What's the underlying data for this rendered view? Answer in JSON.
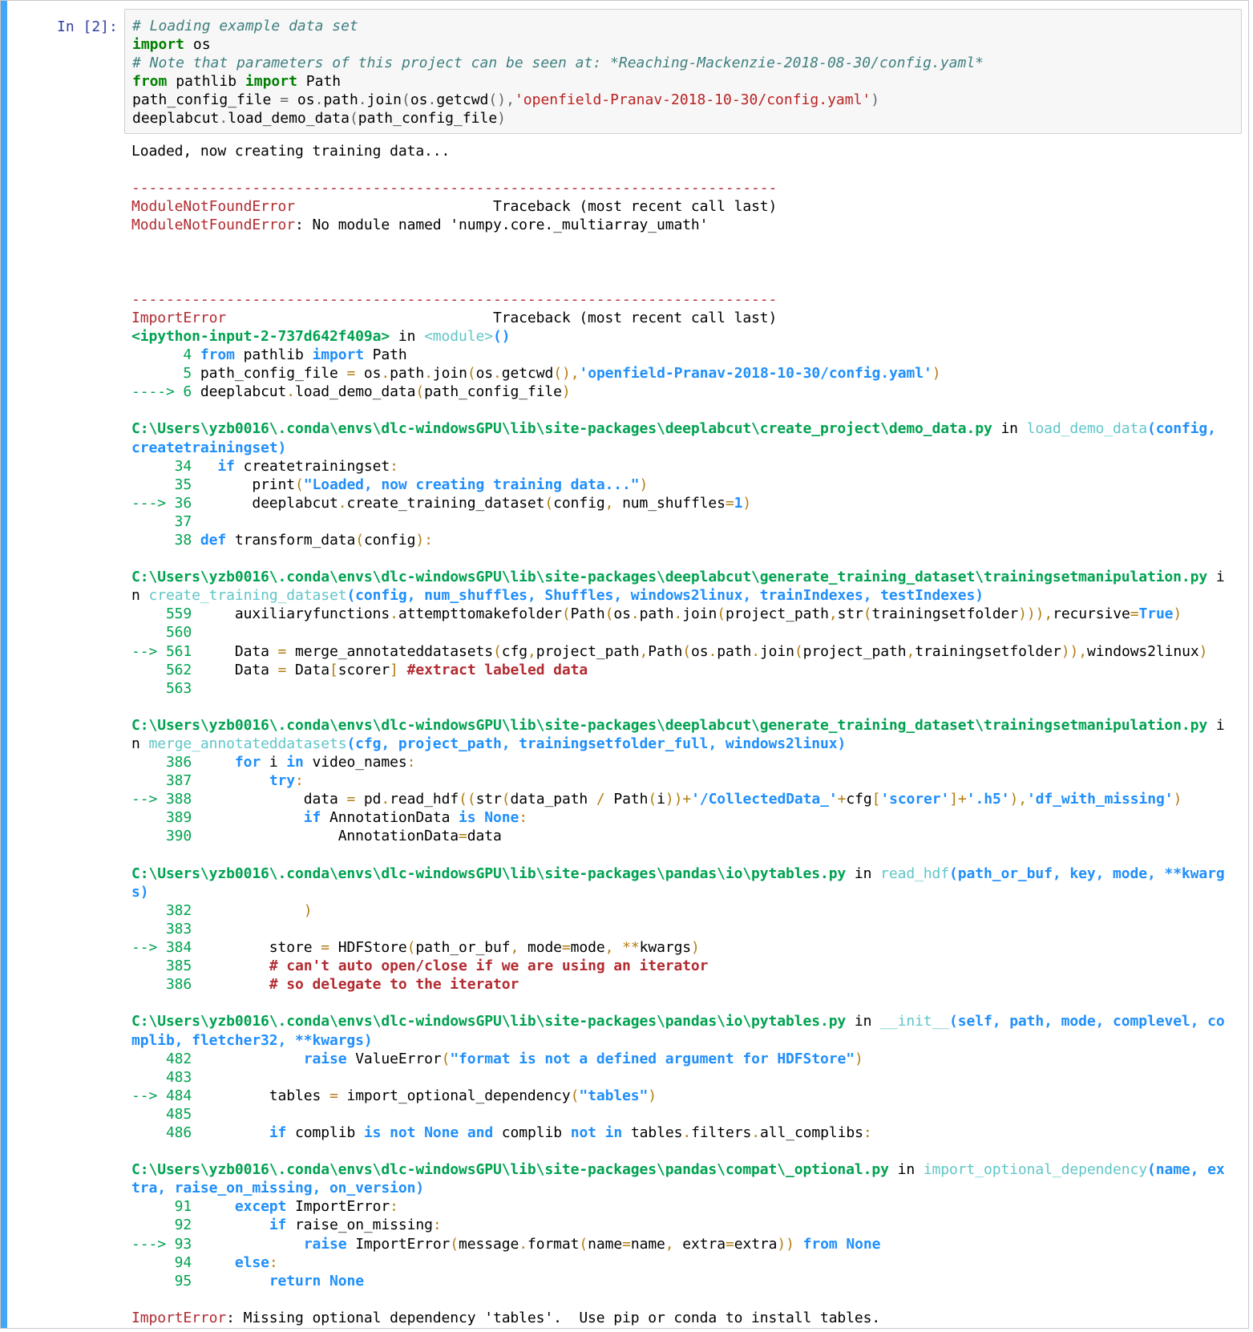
{
  "prompt": "In [2]:",
  "code_lines": [
    "# Loading example data set",
    "import os",
    "# Note that parameters of this project can be seen at: *Reaching-Mackenzie-2018-08-30/config.yaml*",
    "from pathlib import Path",
    "path_config_file = os.path.join(os.getcwd(),'openfield-Pranav-2018-10-30/config.yaml')",
    "deeplabcut.load_demo_data(path_config_file)"
  ],
  "output_lines": [
    "Loaded, now creating training data...",
    "",
    "---------------------------------------------------------------------------",
    "ModuleNotFoundError                       Traceback (most recent call last)",
    "ModuleNotFoundError: No module named 'numpy.core._multiarray_umath'",
    "",
    "",
    "",
    "---------------------------------------------------------------------------",
    "ImportError                               Traceback (most recent call last)",
    "<ipython-input-2-737d642f409a> in <module>()",
    "      4 from pathlib import Path",
    "      5 path_config_file = os.path.join(os.getcwd(),'openfield-Pranav-2018-10-30/config.yaml')",
    "----> 6 deeplabcut.load_demo_data(path_config_file)",
    "",
    "C:\\Users\\yzb0016\\.conda\\envs\\dlc-windowsGPU\\lib\\site-packages\\deeplabcut\\create_project\\demo_data.py in load_demo_data(config,",
    "createtrainingset)",
    "     34   if createtrainingset:",
    "     35       print(\"Loaded, now creating training data...\")",
    "---> 36       deeplabcut.create_training_dataset(config, num_shuffles=1)",
    "     37",
    "     38 def transform_data(config):",
    "",
    "C:\\Users\\yzb0016\\.conda\\envs\\dlc-windowsGPU\\lib\\site-packages\\deeplabcut\\generate_training_dataset\\trainingsetmanipulation.py i",
    "n create_training_dataset(config, num_shuffles, Shuffles, windows2linux, trainIndexes, testIndexes)",
    "    559     auxiliaryfunctions.attempttomakefolder(Path(os.path.join(project_path,str(trainingsetfolder))),recursive=True)",
    "    560",
    "--> 561     Data = merge_annotateddatasets(cfg,project_path,Path(os.path.join(project_path,trainingsetfolder)),windows2linux)",
    "    562     Data = Data[scorer] #extract labeled data",
    "    563",
    "",
    "C:\\Users\\yzb0016\\.conda\\envs\\dlc-windowsGPU\\lib\\site-packages\\deeplabcut\\generate_training_dataset\\trainingsetmanipulation.py i",
    "n merge_annotateddatasets(cfg, project_path, trainingsetfolder_full, windows2linux)",
    "    386     for i in video_names:",
    "    387         try:",
    "--> 388             data = pd.read_hdf((str(data_path / Path(i))+'/CollectedData_'+cfg['scorer']+'.h5'),'df_with_missing')",
    "    389             if AnnotationData is None:",
    "    390                 AnnotationData=data",
    "",
    "C:\\Users\\yzb0016\\.conda\\envs\\dlc-windowsGPU\\lib\\site-packages\\pandas\\io\\pytables.py in read_hdf(path_or_buf, key, mode, **kwarg",
    "s)",
    "    382             )",
    "    383",
    "--> 384         store = HDFStore(path_or_buf, mode=mode, **kwargs)",
    "    385         # can't auto open/close if we are using an iterator",
    "    386         # so delegate to the iterator",
    "",
    "C:\\Users\\yzb0016\\.conda\\envs\\dlc-windowsGPU\\lib\\site-packages\\pandas\\io\\pytables.py in __init__(self, path, mode, complevel, co",
    "mplib, fletcher32, **kwargs)",
    "    482             raise ValueError(\"format is not a defined argument for HDFStore\")",
    "    483",
    "--> 484         tables = import_optional_dependency(\"tables\")",
    "    485",
    "    486         if complib is not None and complib not in tables.filters.all_complibs:",
    "",
    "C:\\Users\\yzb0016\\.conda\\envs\\dlc-windowsGPU\\lib\\site-packages\\pandas\\compat\\_optional.py in import_optional_dependency(name, ex",
    "tra, raise_on_missing, on_version)",
    "     91     except ImportError:",
    "     92         if raise_on_missing:",
    "---> 93             raise ImportError(message.format(name=name, extra=extra)) from None",
    "     94     else:",
    "     95         return None",
    "",
    "ImportError: Missing optional dependency 'tables'.  Use pip or conda to install tables."
  ]
}
